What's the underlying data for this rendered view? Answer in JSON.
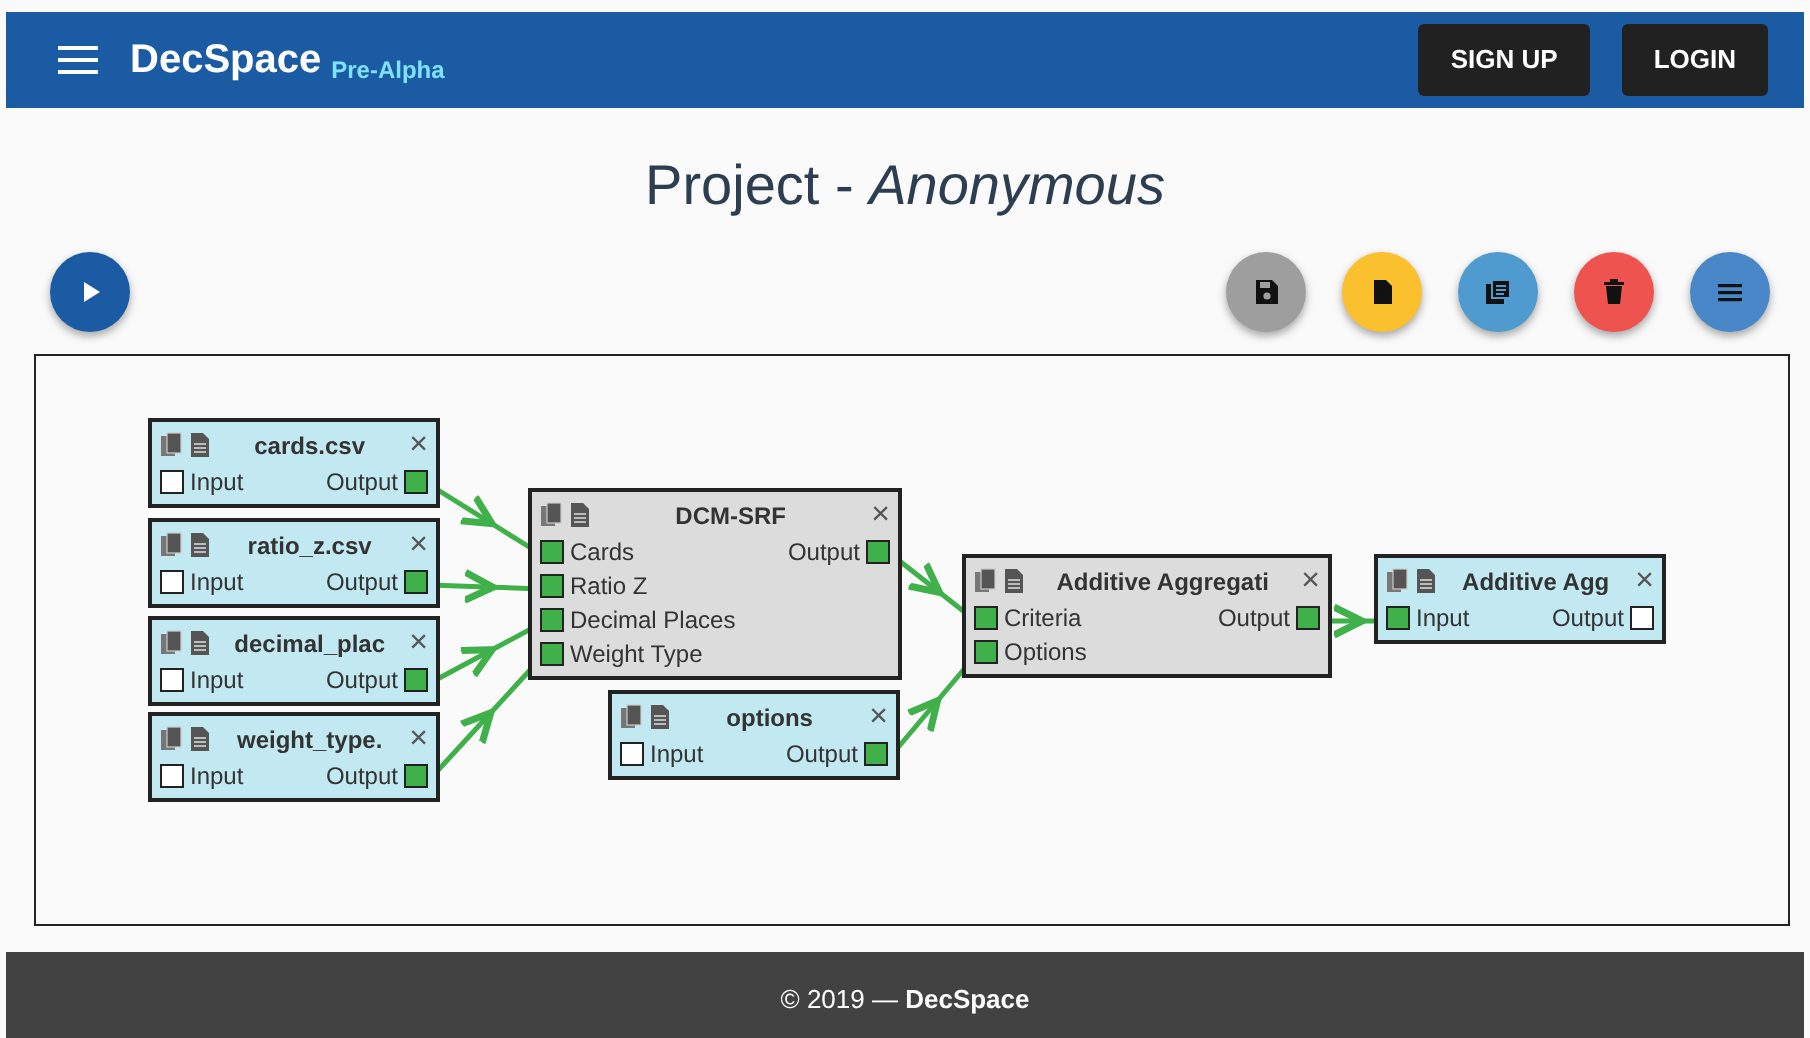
{
  "navbar": {
    "brand": "DecSpace",
    "tag": "Pre-Alpha",
    "buttons": [
      "SIGN UP",
      "LOGIN"
    ]
  },
  "title": "Project - *Anonymous*",
  "toolbar": {
    "run": {
      "color": "#1a5ba3"
    },
    "actions": [
      {
        "kind": "save",
        "color": "#9e9e9e"
      },
      {
        "kind": "new",
        "color": "#fbc02d"
      },
      {
        "kind": "copies",
        "color": "#4f9bd0"
      },
      {
        "kind": "delete",
        "color": "#ef5350"
      },
      {
        "kind": "menu",
        "color": "#4a87c8"
      }
    ]
  },
  "nodes": [
    {
      "kind": "file",
      "title": "cards.csv",
      "close": "×",
      "inputs": [
        {
          "label": "Input",
          "connected": false
        }
      ],
      "outputs": [
        {
          "label": "Output",
          "connected": true
        }
      ]
    },
    {
      "kind": "file",
      "title": "ratio_z.csv",
      "close": "×",
      "inputs": [
        {
          "label": "Input",
          "connected": false
        }
      ],
      "outputs": [
        {
          "label": "Output",
          "connected": true
        }
      ]
    },
    {
      "kind": "file",
      "title": "decimal_plac",
      "close": "×",
      "inputs": [
        {
          "label": "Input",
          "connected": false
        }
      ],
      "outputs": [
        {
          "label": "Output",
          "connected": true
        }
      ]
    },
    {
      "kind": "file",
      "title": "weight_type.",
      "close": "×",
      "inputs": [
        {
          "label": "Input",
          "connected": false
        }
      ],
      "outputs": [
        {
          "label": "Output",
          "connected": true
        }
      ]
    },
    {
      "kind": "process",
      "title": "DCM-SRF",
      "close": "×",
      "inputs": [
        {
          "label": "Cards",
          "connected": true
        },
        {
          "label": "Ratio Z",
          "connected": true
        },
        {
          "label": "Decimal Places",
          "connected": true
        },
        {
          "label": "Weight Type",
          "connected": true
        }
      ],
      "outputs": [
        {
          "label": "Output",
          "connected": true
        }
      ]
    },
    {
      "kind": "file",
      "title": "options",
      "close": "×",
      "inputs": [
        {
          "label": "Input",
          "connected": false
        }
      ],
      "outputs": [
        {
          "label": "Output",
          "connected": true
        }
      ]
    },
    {
      "kind": "process",
      "title": "Additive Aggregati",
      "close": "×",
      "inputs": [
        {
          "label": "Criteria",
          "connected": true
        },
        {
          "label": "Options",
          "connected": true
        }
      ],
      "outputs": [
        {
          "label": "Output",
          "connected": true
        }
      ]
    },
    {
      "kind": "file",
      "title": "Additive Agg",
      "close": "×",
      "inputs": [
        {
          "label": "Input",
          "connected": true
        }
      ],
      "outputs": [
        {
          "label": "Output",
          "connected": false
        }
      ]
    }
  ],
  "footer": "© 2019 — **DecSpace**"
}
